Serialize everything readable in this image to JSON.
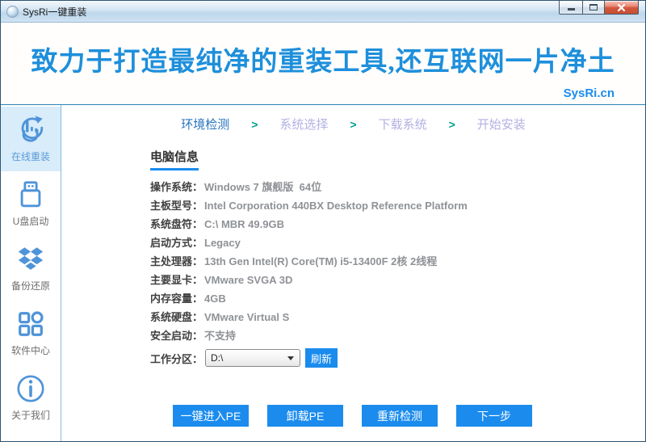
{
  "window": {
    "title": "SysRi一键重装"
  },
  "banner": {
    "slogan": "致力于打造最纯净的重装工具,还互联网一片净土",
    "site": "SysRi.cn"
  },
  "steps": {
    "separator": ">",
    "items": [
      {
        "label": "环境检测",
        "active": true
      },
      {
        "label": "系统选择",
        "active": false
      },
      {
        "label": "下载系统",
        "active": false
      },
      {
        "label": "开始安装",
        "active": false
      }
    ]
  },
  "sidebar": {
    "items": [
      {
        "label": "在线重装",
        "icon": "online-reinstall-icon",
        "active": true
      },
      {
        "label": "U盘启动",
        "icon": "usb-boot-icon",
        "active": false
      },
      {
        "label": "备份还原",
        "icon": "backup-restore-icon",
        "active": false
      },
      {
        "label": "软件中心",
        "icon": "software-center-icon",
        "active": false
      },
      {
        "label": "关于我们",
        "icon": "about-us-icon",
        "active": false
      }
    ]
  },
  "main": {
    "section_title": "电脑信息",
    "info": [
      {
        "label": "操作系统：",
        "value": "Windows 7 旗舰版  64位"
      },
      {
        "label": "主板型号：",
        "value": "Intel Corporation 440BX Desktop Reference Platform"
      },
      {
        "label": "系统盘符：",
        "value": "C:\\ MBR 49.9GB"
      },
      {
        "label": "启动方式：",
        "value": "Legacy"
      },
      {
        "label": "主处理器：",
        "value": "13th Gen Intel(R) Core(TM) i5-13400F 2核 2线程"
      },
      {
        "label": "主要显卡：",
        "value": "VMware SVGA 3D"
      },
      {
        "label": "内存容量：",
        "value": "4GB"
      },
      {
        "label": "系统硬盘：",
        "value": "VMware Virtual S"
      },
      {
        "label": "安全启动：",
        "value": "不支持"
      }
    ],
    "partition": {
      "label": "工作分区：",
      "selected": "D:\\",
      "refresh_label": "刷新"
    }
  },
  "footer": {
    "buttons": [
      "一键进入PE",
      "卸载PE",
      "重新检测",
      "下一步"
    ]
  },
  "colors": {
    "accent": "#1b8cee",
    "icon_blue": "#4f94d8",
    "step_active": "#2573be",
    "step_inactive": "#b3b0e4",
    "step_separator": "#00a08c",
    "banner_text": "#1e8fdb"
  }
}
